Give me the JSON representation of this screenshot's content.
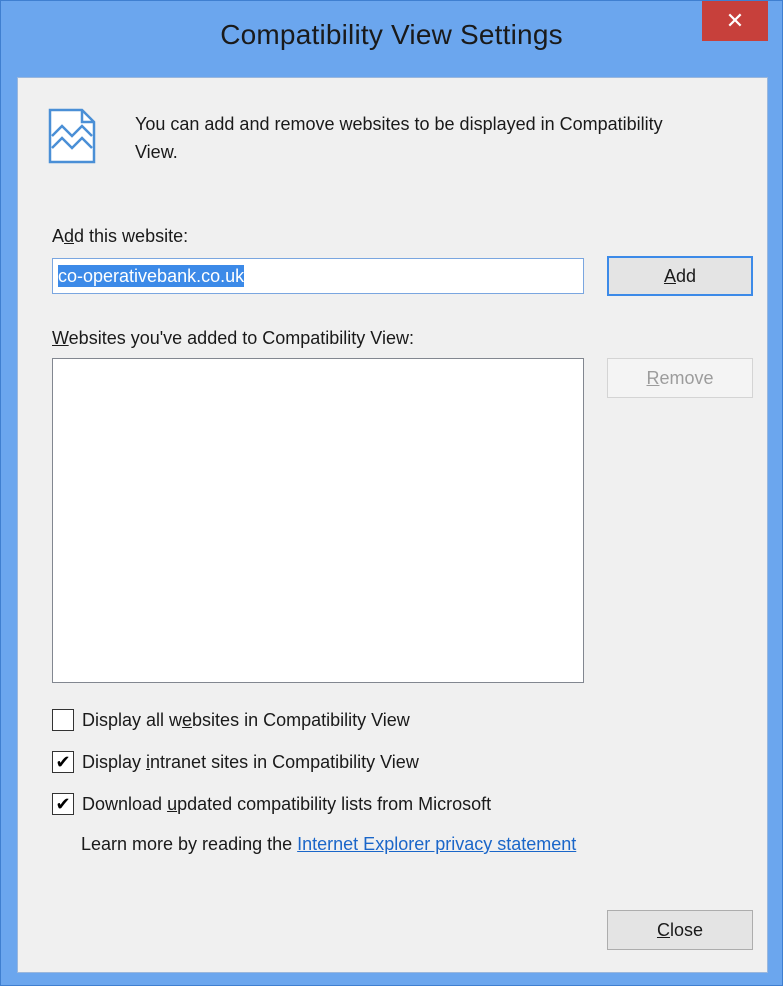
{
  "window": {
    "title": "Compatibility View Settings",
    "close_glyph": "✕"
  },
  "info": {
    "icon": "compatibility-view-icon",
    "text": "You can add and remove websites to be displayed in Compatibility View."
  },
  "add_section": {
    "label_pre": "A",
    "label_accel": "d",
    "label_post": "d this website:",
    "input_value": "co-operativebank.co.uk",
    "add_button_accel": "A",
    "add_button_rest": "dd"
  },
  "list_section": {
    "label_accel": "W",
    "label_post": "ebsites you've added to Compatibility View:",
    "items": [],
    "remove_button_accel": "R",
    "remove_button_rest": "emove"
  },
  "options": {
    "all_websites": {
      "checked": false,
      "label_pre": "Display all w",
      "label_accel": "e",
      "label_post": "bsites in Compatibility View"
    },
    "intranet": {
      "checked": true,
      "label_pre": "Display ",
      "label_accel": "i",
      "label_post": "ntranet sites in Compatibility View"
    },
    "download_lists": {
      "checked": true,
      "label_pre": "Download ",
      "label_accel": "u",
      "label_post": "pdated compatibility lists from Microsoft"
    }
  },
  "learn_more": {
    "text": "Learn more by reading the ",
    "link": "Internet Explorer privacy statement"
  },
  "footer": {
    "close_button_accel": "C",
    "close_button_rest": "lose"
  },
  "colors": {
    "title_bar": "#6ba6ee",
    "close_button": "#c7403b",
    "selection": "#3c8ae8",
    "link": "#1a66c9"
  }
}
